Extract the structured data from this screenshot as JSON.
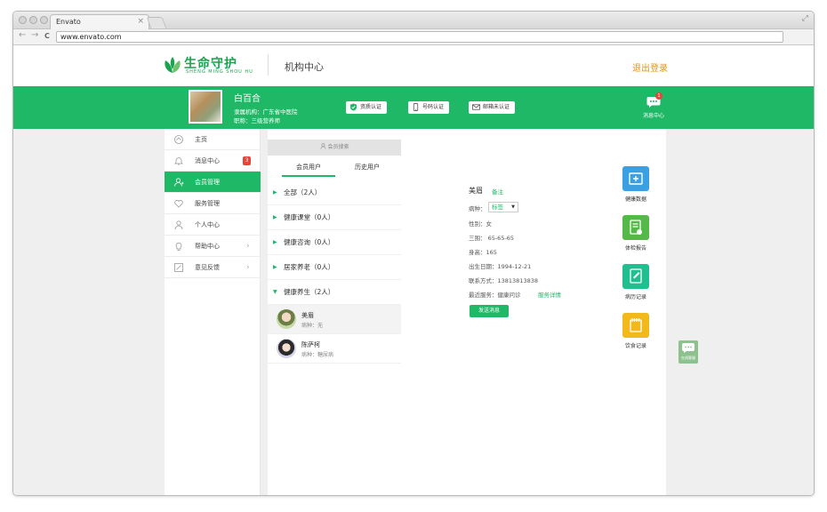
{
  "browser": {
    "tab_title": "Envato",
    "tab_close": "×",
    "url": "www.envato.com",
    "back": "←",
    "forward": "→",
    "reload": "C",
    "expand": "⤢"
  },
  "header": {
    "logo_text": "生命守护",
    "logo_sub": "SHENG MING SHOU HU",
    "title": "机构中心",
    "logout": "退出登录"
  },
  "profile": {
    "name": "白百合",
    "institution": "隶属机构：广东省中医院",
    "position": "职称：三级营养师",
    "certs": [
      "资质认证",
      "号码认证",
      "邮箱未认证"
    ],
    "message_center": "消息中心",
    "message_count": "1"
  },
  "sidebar": {
    "items": [
      {
        "label": "主页",
        "icon": "home-icon"
      },
      {
        "label": "消息中心",
        "icon": "bell-icon",
        "badge": "3"
      },
      {
        "label": "会员管理",
        "icon": "member-icon",
        "active": true
      },
      {
        "label": "服务管理",
        "icon": "heart-icon"
      },
      {
        "label": "个人中心",
        "icon": "user-icon"
      },
      {
        "label": "帮助中心",
        "icon": "bulb-icon",
        "chevron": "›"
      },
      {
        "label": "意见反馈",
        "icon": "feedback-icon",
        "chevron": "›"
      }
    ]
  },
  "users": {
    "search_placeholder": "会员搜索",
    "add": "+",
    "tabs": [
      "会员用户",
      "历史用户"
    ],
    "groups": [
      {
        "label": "全部（2人）",
        "arrow": "▶"
      },
      {
        "label": "健康课堂（0人）",
        "arrow": "▶"
      },
      {
        "label": "健康咨询（0人）",
        "arrow": "▶"
      },
      {
        "label": "居家养老（0人）",
        "arrow": "▶"
      },
      {
        "label": "健康养生（2人）",
        "arrow": "▼"
      }
    ],
    "members": [
      {
        "name": "美眉",
        "disease": "病种：无"
      },
      {
        "name": "陈萨柯",
        "disease": "病种：糖尿病"
      }
    ]
  },
  "detail": {
    "name": "美眉",
    "note": "备注",
    "disease_label": "病种：",
    "disease_value": "标签",
    "caret": "▼",
    "gender": "性别：女",
    "measurements": "三围：  65-65-65",
    "height": "身高：165",
    "birthday": "出生日期：1994-12-21",
    "contact": "联系方式：13813813838",
    "recent": "最近服务：健康问诊",
    "service_link": "服务详情",
    "send_button": "发送消息",
    "tiles": [
      {
        "label": "健康数据",
        "color": "#3aa0e3"
      },
      {
        "label": "体检报告",
        "color": "#54b948"
      },
      {
        "label": "病历记录",
        "color": "#1fbf8f"
      },
      {
        "label": "饮食记录",
        "color": "#f2b91a"
      }
    ]
  },
  "float": {
    "label": "在线客服"
  }
}
